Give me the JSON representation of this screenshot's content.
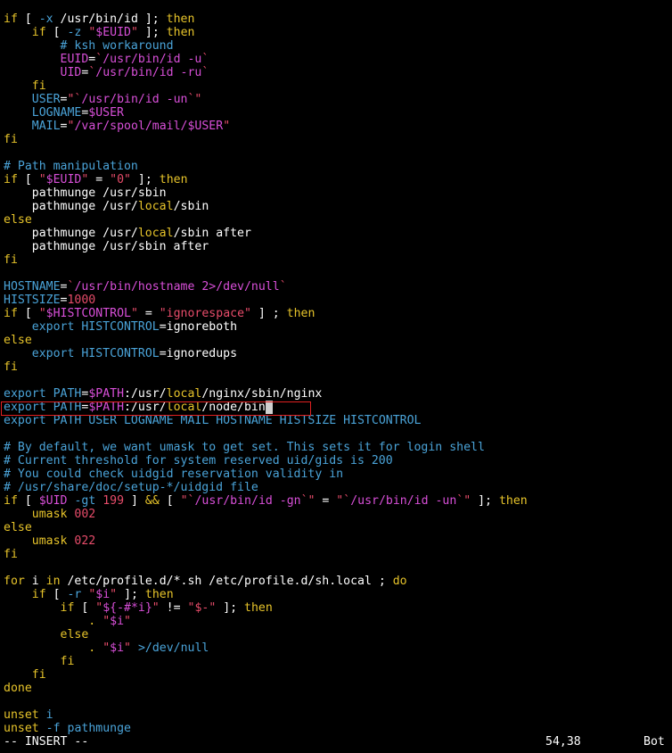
{
  "editor": {
    "lines": [
      [
        [
          "y",
          "if"
        ],
        [
          "w",
          " [ "
        ],
        [
          "c",
          "-x"
        ],
        [
          "w",
          " /usr/bin/id ]; "
        ],
        [
          "y",
          "then"
        ]
      ],
      [
        [
          "w",
          "    "
        ],
        [
          "y",
          "if"
        ],
        [
          "w",
          " [ "
        ],
        [
          "c",
          "-z"
        ],
        [
          "w",
          " "
        ],
        [
          "p",
          "\""
        ],
        [
          "m",
          "$EUID"
        ],
        [
          "p",
          "\""
        ],
        [
          "w",
          " ]; "
        ],
        [
          "y",
          "then"
        ]
      ],
      [
        [
          "w",
          "        "
        ],
        [
          "c",
          "# ksh workaround"
        ]
      ],
      [
        [
          "w",
          "        "
        ],
        [
          "m",
          "EUID"
        ],
        [
          "w",
          "="
        ],
        [
          "p",
          "`"
        ],
        [
          "m",
          "/usr/bin/id -u"
        ],
        [
          "p",
          "`"
        ]
      ],
      [
        [
          "w",
          "        "
        ],
        [
          "m",
          "UID"
        ],
        [
          "w",
          "="
        ],
        [
          "p",
          "`"
        ],
        [
          "m",
          "/usr/bin/id -ru"
        ],
        [
          "p",
          "`"
        ]
      ],
      [
        [
          "w",
          "    "
        ],
        [
          "y",
          "fi"
        ]
      ],
      [
        [
          "w",
          "    "
        ],
        [
          "c",
          "USER"
        ],
        [
          "w",
          "="
        ],
        [
          "p",
          "\"`"
        ],
        [
          "m",
          "/usr/bin/id -un"
        ],
        [
          "p",
          "`\""
        ]
      ],
      [
        [
          "w",
          "    "
        ],
        [
          "c",
          "LOGNAME"
        ],
        [
          "w",
          "="
        ],
        [
          "m",
          "$USER"
        ]
      ],
      [
        [
          "w",
          "    "
        ],
        [
          "c",
          "MAIL"
        ],
        [
          "w",
          "="
        ],
        [
          "p",
          "\""
        ],
        [
          "m",
          "/var/spool/mail/"
        ],
        [
          "m",
          "$USER"
        ],
        [
          "p",
          "\""
        ]
      ],
      [
        [
          "y",
          "fi"
        ]
      ],
      [
        [
          "w",
          ""
        ]
      ],
      [
        [
          "c",
          "# Path manipulation"
        ]
      ],
      [
        [
          "y",
          "if"
        ],
        [
          "w",
          " [ "
        ],
        [
          "p",
          "\""
        ],
        [
          "m",
          "$EUID"
        ],
        [
          "p",
          "\""
        ],
        [
          "w",
          " = "
        ],
        [
          "p",
          "\"0\""
        ],
        [
          "w",
          " ]; "
        ],
        [
          "y",
          "then"
        ]
      ],
      [
        [
          "w",
          "    pathmunge /usr/sbin"
        ]
      ],
      [
        [
          "w",
          "    pathmunge /usr/"
        ],
        [
          "y",
          "local"
        ],
        [
          "w",
          "/sbin"
        ]
      ],
      [
        [
          "y",
          "else"
        ]
      ],
      [
        [
          "w",
          "    pathmunge /usr/"
        ],
        [
          "y",
          "local"
        ],
        [
          "w",
          "/sbin after"
        ]
      ],
      [
        [
          "w",
          "    pathmunge /usr/sbin after"
        ]
      ],
      [
        [
          "y",
          "fi"
        ]
      ],
      [
        [
          "w",
          ""
        ]
      ],
      [
        [
          "c",
          "HOSTNAME"
        ],
        [
          "w",
          "="
        ],
        [
          "p",
          "`"
        ],
        [
          "m",
          "/usr/bin/hostname 2>/dev/null"
        ],
        [
          "p",
          "`"
        ]
      ],
      [
        [
          "c",
          "HISTSIZE"
        ],
        [
          "w",
          "="
        ],
        [
          "p",
          "1000"
        ]
      ],
      [
        [
          "y",
          "if"
        ],
        [
          "w",
          " [ "
        ],
        [
          "p",
          "\""
        ],
        [
          "m",
          "$HISTCONTROL"
        ],
        [
          "p",
          "\""
        ],
        [
          "w",
          " = "
        ],
        [
          "p",
          "\"ignorespace\""
        ],
        [
          "w",
          " ] ; "
        ],
        [
          "y",
          "then"
        ]
      ],
      [
        [
          "w",
          "    "
        ],
        [
          "c",
          "export"
        ],
        [
          "w",
          " "
        ],
        [
          "c",
          "HISTCONTROL"
        ],
        [
          "w",
          "=ignoreboth"
        ]
      ],
      [
        [
          "y",
          "else"
        ]
      ],
      [
        [
          "w",
          "    "
        ],
        [
          "c",
          "export"
        ],
        [
          "w",
          " "
        ],
        [
          "c",
          "HISTCONTROL"
        ],
        [
          "w",
          "=ignoredups"
        ]
      ],
      [
        [
          "y",
          "fi"
        ]
      ],
      [
        [
          "w",
          ""
        ]
      ],
      [
        [
          "c",
          "export"
        ],
        [
          "w",
          " "
        ],
        [
          "c",
          "PATH"
        ],
        [
          "w",
          "="
        ],
        [
          "m",
          "$PATH"
        ],
        [
          "w",
          ":/usr/"
        ],
        [
          "y",
          "local"
        ],
        [
          "w",
          "/nginx/sbin/nginx"
        ]
      ],
      [
        [
          "c",
          "export"
        ],
        [
          "w",
          " "
        ],
        [
          "c",
          "PATH"
        ],
        [
          "w",
          "="
        ],
        [
          "m",
          "$PATH"
        ],
        [
          "w",
          ":/usr/"
        ],
        [
          "y",
          "local"
        ],
        [
          "w",
          "/node/bin"
        ],
        [
          "cursor",
          " "
        ]
      ],
      [
        [
          "c",
          "export"
        ],
        [
          "w",
          " "
        ],
        [
          "c",
          "PATH USER LOGNAME MAIL HOSTNAME HISTSIZE HISTCONTROL"
        ]
      ],
      [
        [
          "w",
          ""
        ]
      ],
      [
        [
          "c",
          "# By default, we want umask to get set. This sets it for login shell"
        ]
      ],
      [
        [
          "c",
          "# Current threshold for system reserved uid/gids is 200"
        ]
      ],
      [
        [
          "c",
          "# You could check uidgid reservation validity in"
        ]
      ],
      [
        [
          "c",
          "# /usr/share/doc/setup-*/uidgid file"
        ]
      ],
      [
        [
          "y",
          "if"
        ],
        [
          "w",
          " [ "
        ],
        [
          "m",
          "$UID"
        ],
        [
          "w",
          " "
        ],
        [
          "c",
          "-gt"
        ],
        [
          "w",
          " "
        ],
        [
          "p",
          "199"
        ],
        [
          "w",
          " ] "
        ],
        [
          "y",
          "&&"
        ],
        [
          "w",
          " [ "
        ],
        [
          "p",
          "\"`"
        ],
        [
          "m",
          "/usr/bin/id -gn"
        ],
        [
          "p",
          "`\""
        ],
        [
          "w",
          " = "
        ],
        [
          "p",
          "\"`"
        ],
        [
          "m",
          "/usr/bin/id -un"
        ],
        [
          "p",
          "`\""
        ],
        [
          "w",
          " ]; "
        ],
        [
          "y",
          "then"
        ]
      ],
      [
        [
          "w",
          "    "
        ],
        [
          "y",
          "umask"
        ],
        [
          "w",
          " "
        ],
        [
          "p",
          "002"
        ]
      ],
      [
        [
          "y",
          "else"
        ]
      ],
      [
        [
          "w",
          "    "
        ],
        [
          "y",
          "umask"
        ],
        [
          "w",
          " "
        ],
        [
          "p",
          "022"
        ]
      ],
      [
        [
          "y",
          "fi"
        ]
      ],
      [
        [
          "w",
          ""
        ]
      ],
      [
        [
          "y",
          "for"
        ],
        [
          "w",
          " i "
        ],
        [
          "y",
          "in"
        ],
        [
          "w",
          " /etc/profile.d/*.sh /etc/profile.d/sh.local ; "
        ],
        [
          "y",
          "do"
        ]
      ],
      [
        [
          "w",
          "    "
        ],
        [
          "y",
          "if"
        ],
        [
          "w",
          " [ "
        ],
        [
          "c",
          "-r"
        ],
        [
          "w",
          " "
        ],
        [
          "p",
          "\""
        ],
        [
          "m",
          "$i"
        ],
        [
          "p",
          "\""
        ],
        [
          "w",
          " ]; "
        ],
        [
          "y",
          "then"
        ]
      ],
      [
        [
          "w",
          "        "
        ],
        [
          "y",
          "if"
        ],
        [
          "w",
          " [ "
        ],
        [
          "p",
          "\""
        ],
        [
          "m",
          "${-#*i}"
        ],
        [
          "p",
          "\""
        ],
        [
          "w",
          " != "
        ],
        [
          "p",
          "\"$-\""
        ],
        [
          "w",
          " ]; "
        ],
        [
          "y",
          "then"
        ]
      ],
      [
        [
          "w",
          "            "
        ],
        [
          "y",
          "."
        ],
        [
          "w",
          " "
        ],
        [
          "p",
          "\""
        ],
        [
          "m",
          "$i"
        ],
        [
          "p",
          "\""
        ]
      ],
      [
        [
          "w",
          "        "
        ],
        [
          "y",
          "else"
        ]
      ],
      [
        [
          "w",
          "            "
        ],
        [
          "y",
          "."
        ],
        [
          "w",
          " "
        ],
        [
          "p",
          "\""
        ],
        [
          "m",
          "$i"
        ],
        [
          "p",
          "\""
        ],
        [
          "w",
          " "
        ],
        [
          "c",
          ">/dev/null"
        ]
      ],
      [
        [
          "w",
          "        "
        ],
        [
          "y",
          "fi"
        ]
      ],
      [
        [
          "w",
          "    "
        ],
        [
          "y",
          "fi"
        ]
      ],
      [
        [
          "y",
          "done"
        ]
      ],
      [
        [
          "w",
          ""
        ]
      ],
      [
        [
          "y",
          "unset"
        ],
        [
          "w",
          " "
        ],
        [
          "c",
          "i"
        ]
      ],
      [
        [
          "y",
          "unset"
        ],
        [
          "w",
          " "
        ],
        [
          "c",
          "-f"
        ],
        [
          "w",
          " "
        ],
        [
          "c",
          "pathmunge"
        ]
      ]
    ]
  },
  "status": {
    "mode": "-- INSERT --",
    "position": "54,38",
    "scroll": "Bot"
  }
}
